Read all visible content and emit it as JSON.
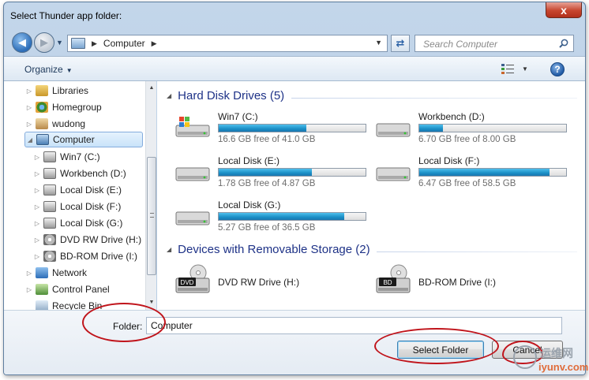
{
  "window": {
    "title": "Select Thunder app folder:",
    "close_label": "x"
  },
  "navbar": {
    "address_path": "Computer",
    "search_placeholder": "Search Computer"
  },
  "command_bar": {
    "organize_label": "Organize"
  },
  "nav_tree": [
    {
      "label": "Libraries",
      "icon": "libraries-icon",
      "level": 0
    },
    {
      "label": "Homegroup",
      "icon": "homegroup-icon",
      "level": 0
    },
    {
      "label": "wudong",
      "icon": "user-folder-icon",
      "level": 0
    },
    {
      "label": "Computer",
      "icon": "computer-icon",
      "level": 0,
      "selected": true,
      "expanded": true
    },
    {
      "label": "Win7 (C:)",
      "icon": "drive-icon",
      "level": 1
    },
    {
      "label": "Workbench (D:)",
      "icon": "drive-icon",
      "level": 1
    },
    {
      "label": "Local Disk (E:)",
      "icon": "drive-icon",
      "level": 1
    },
    {
      "label": "Local Disk (F:)",
      "icon": "drive-icon",
      "level": 1
    },
    {
      "label": "Local Disk (G:)",
      "icon": "drive-icon",
      "level": 1
    },
    {
      "label": "DVD RW Drive (H:)",
      "icon": "dvd-drive-icon",
      "level": 1
    },
    {
      "label": "BD-ROM Drive (I:)",
      "icon": "dvd-drive-icon",
      "level": 1
    },
    {
      "label": "Network",
      "icon": "network-icon",
      "level": 0
    },
    {
      "label": "Control Panel",
      "icon": "control-panel-icon",
      "level": 0
    },
    {
      "label": "Recycle Bin",
      "icon": "recycle-bin-icon",
      "level": 0
    }
  ],
  "groups": {
    "hard_disks": {
      "header": "Hard Disk Drives (5)",
      "drives": [
        {
          "name": "Win7 (C:)",
          "free_text": "16.6 GB free of 41.0 GB",
          "used_fraction": 0.595
        },
        {
          "name": "Workbench (D:)",
          "free_text": "6.70 GB free of 8.00 GB",
          "used_fraction": 0.163
        },
        {
          "name": "Local Disk (E:)",
          "free_text": "1.78 GB free of 4.87 GB",
          "used_fraction": 0.634
        },
        {
          "name": "Local Disk (F:)",
          "free_text": "6.47 GB free of 58.5 GB",
          "used_fraction": 0.889
        },
        {
          "name": "Local Disk (G:)",
          "free_text": "5.27 GB free of 36.5 GB",
          "used_fraction": 0.856
        }
      ]
    },
    "removable": {
      "header": "Devices with Removable Storage (2)",
      "drives": [
        {
          "name": "DVD RW Drive (H:)",
          "badge": "DVD"
        },
        {
          "name": "BD-ROM Drive (I:)",
          "badge": "BD"
        }
      ]
    }
  },
  "footer": {
    "folder_label": "Folder:",
    "folder_value": "Computer",
    "select_button": "Select Folder",
    "cancel_button": "Cancel"
  },
  "watermark": {
    "top": "运维网",
    "bottom": "iyunv.com"
  },
  "colors": {
    "accent_blue": "#1e3287",
    "usage_bar": "#1a8fc6",
    "annotation_red": "#c0141b"
  }
}
